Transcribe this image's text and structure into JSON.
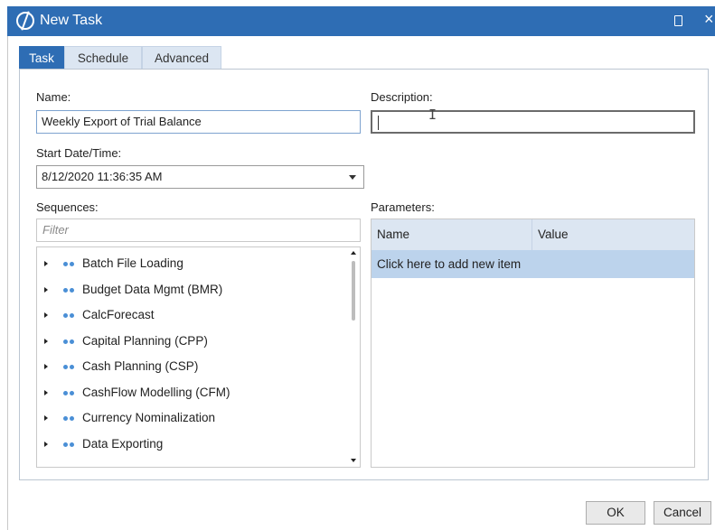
{
  "window": {
    "title": "New Task"
  },
  "tabs": [
    {
      "label": "Task"
    },
    {
      "label": "Schedule"
    },
    {
      "label": "Advanced"
    }
  ],
  "form": {
    "name_label": "Name:",
    "name_value": "Weekly Export of Trial Balance",
    "description_label": "Description:",
    "description_value": "",
    "start_label": "Start Date/Time:",
    "start_value": "8/12/2020 11:36:35 AM",
    "sequences_label": "Sequences:",
    "filter_placeholder": "Filter",
    "parameters_label": "Parameters:"
  },
  "sequences": [
    {
      "label": "Batch File Loading"
    },
    {
      "label": "Budget Data Mgmt (BMR)"
    },
    {
      "label": "CalcForecast"
    },
    {
      "label": "Capital Planning (CPP)"
    },
    {
      "label": "Cash Planning (CSP)"
    },
    {
      "label": "CashFlow Modelling (CFM)"
    },
    {
      "label": "Currency Nominalization"
    },
    {
      "label": "Data Exporting"
    }
  ],
  "parameters": {
    "columns": [
      "Name",
      "Value"
    ],
    "add_row_text": "Click here to add new item"
  },
  "buttons": {
    "ok": "OK",
    "cancel": "Cancel"
  },
  "colors": {
    "accent": "#2e6db4",
    "tab_inactive": "#dce6f2",
    "row_highlight": "#bcd3ec",
    "dot": "#4a8fd6"
  },
  "icons": [
    "app-logo-icon",
    "restore-icon",
    "close-icon",
    "expand-arrow-icon",
    "sequence-dots-icon",
    "dropdown-arrow-icon",
    "scroll-up-icon",
    "scroll-down-icon",
    "text-cursor-icon"
  ]
}
